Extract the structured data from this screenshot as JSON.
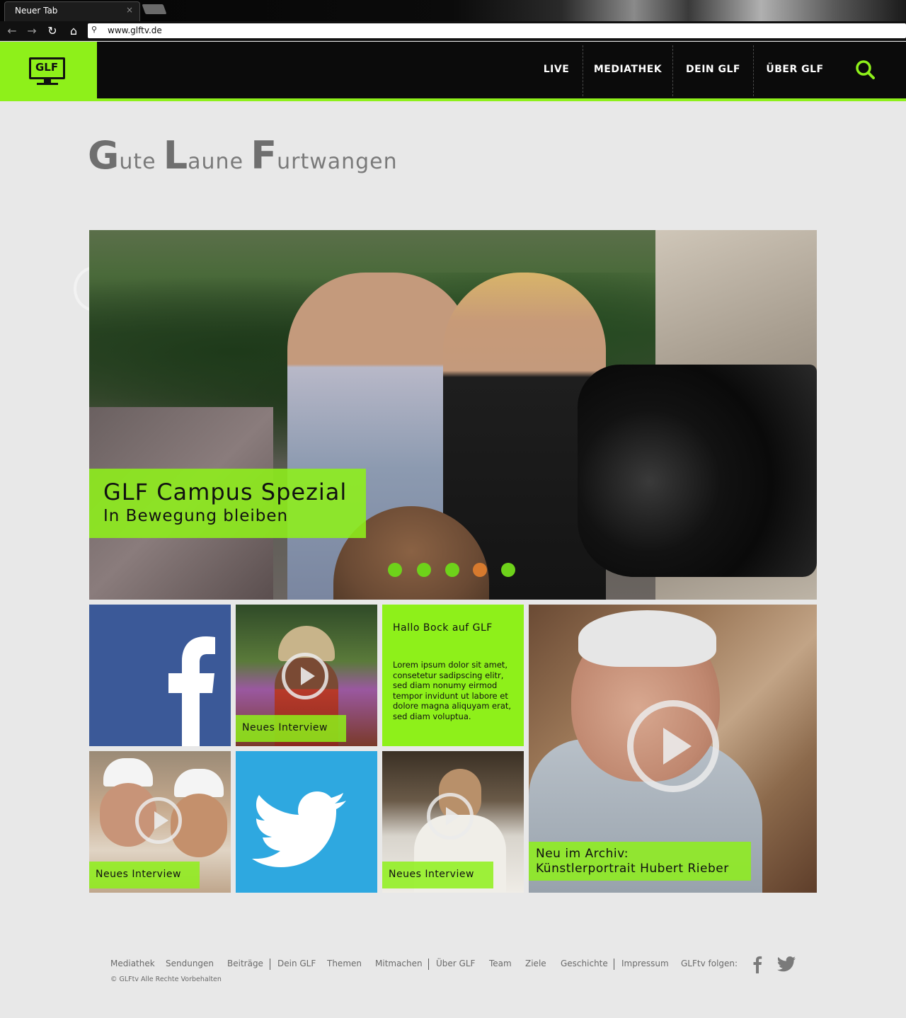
{
  "browser": {
    "tab_title": "Neuer Tab",
    "tab_close": "×",
    "url": "www.glftv.de"
  },
  "site": {
    "logo_text": "GLF",
    "nav": [
      "LIVE",
      "MEDIATHEK",
      "DEIN GLF",
      "ÜBER GLF"
    ],
    "accent_color": "#8ef01a"
  },
  "headline": {
    "words": [
      {
        "initial": "G",
        "rest": "ute"
      },
      {
        "initial": "L",
        "rest": "aune"
      },
      {
        "initial": "F",
        "rest": "urtwangen"
      }
    ]
  },
  "hero": {
    "title": "GLF Campus Spezial",
    "subtitle": "In Bewegung bleiben",
    "slide_count": 5,
    "active_slide": 4
  },
  "tiles": {
    "facebook_icon": "facebook-icon",
    "twitter_icon": "twitter-icon",
    "interview_label": "Neues Interview",
    "text_tile": {
      "title": "Hallo Bock auf GLF",
      "body": "Lorem ipsum dolor sit amet, consetetur sadipscing elitr, sed diam nonumy eirmod tempor invidunt ut labore et dolore magna aliquyam erat, sed diam voluptua."
    },
    "archive": {
      "line1": "Neu im Archiv:",
      "line2": "Künstlerportrait Hubert Rieber"
    }
  },
  "footer": {
    "links": [
      "Mediathek",
      "Sendungen",
      "Beiträge",
      "Dein GLF",
      "Themen",
      "Mitmachen",
      "Über GLF",
      "Team",
      "Ziele",
      "Geschichte",
      "Impressum"
    ],
    "follow_label": "GLFtv folgen:",
    "copyright": "© GLFtv Alle Rechte Vorbehalten"
  }
}
